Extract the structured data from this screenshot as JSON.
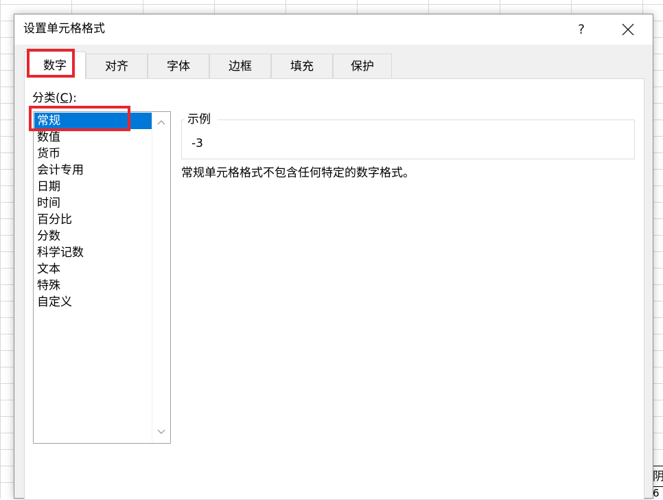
{
  "dialog": {
    "title": "设置单元格格式",
    "help_label": "?",
    "close_icon": "close-icon"
  },
  "tabs": [
    {
      "label": "数字",
      "active": true
    },
    {
      "label": "对齐",
      "active": false
    },
    {
      "label": "字体",
      "active": false
    },
    {
      "label": "边框",
      "active": false
    },
    {
      "label": "填充",
      "active": false
    },
    {
      "label": "保护",
      "active": false
    }
  ],
  "category": {
    "label_prefix": "分类(",
    "label_hotkey": "C",
    "label_suffix": "):",
    "items": [
      "常规",
      "数值",
      "货币",
      "会计专用",
      "日期",
      "时间",
      "百分比",
      "分数",
      "科学记数",
      "文本",
      "特殊",
      "自定义"
    ],
    "selected": "常规"
  },
  "sample": {
    "label": "示例",
    "value": "-3"
  },
  "description": "常规单元格格式不包含任何特定的数字格式。",
  "background_cells": [
    "阴",
    "6"
  ],
  "colors": {
    "highlight_box": "#e8262c",
    "selection": "#0078d7"
  }
}
